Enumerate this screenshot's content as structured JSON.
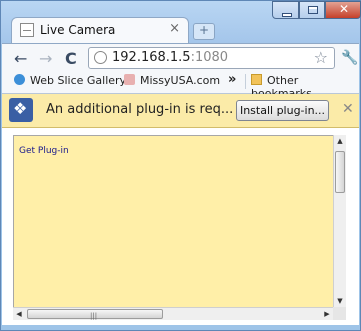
{
  "tab": {
    "title": "Live Camera",
    "close": "×"
  },
  "new_tab": "+",
  "window_controls": {
    "close": "✕"
  },
  "toolbar": {
    "back": "←",
    "forward": "→",
    "reload": "C",
    "url_host": "192.168.1.5",
    "url_port": ":1080",
    "star": "☆",
    "wrench": "🔧"
  },
  "bookmarks": {
    "items": [
      "Web Slice Gallery",
      "MissyUSA.com"
    ],
    "more": "»",
    "other": "Other bookmarks"
  },
  "infobar": {
    "message": "An additional plug-in is req...",
    "install_label": "Install plug-in...",
    "close": "✕"
  },
  "plugin": {
    "link": "Get Plug-in"
  },
  "colors": {
    "infobar": "#fbeba8",
    "plugin_bg": "#ffefa8",
    "frame": "#9ec4e8"
  }
}
